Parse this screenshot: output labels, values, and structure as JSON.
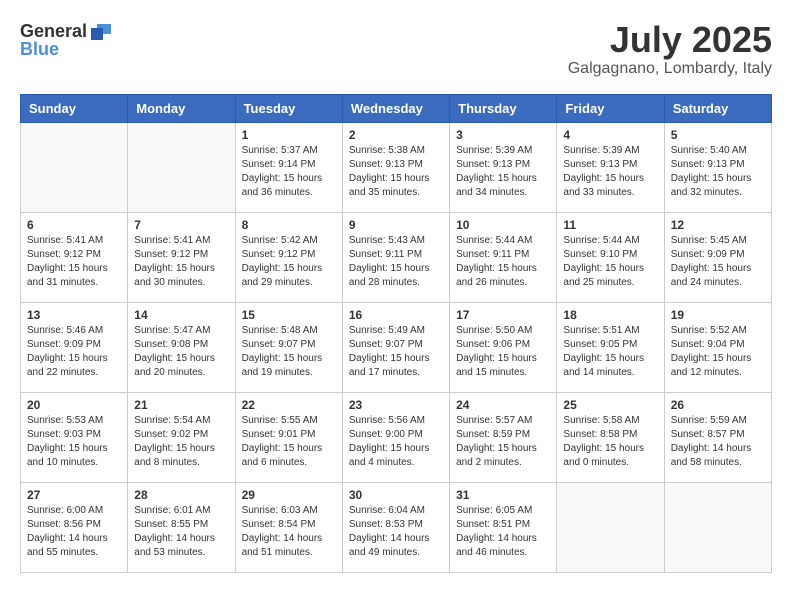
{
  "header": {
    "logo_general": "General",
    "logo_blue": "Blue",
    "title": "July 2025",
    "location": "Galgagnano, Lombardy, Italy"
  },
  "days_of_week": [
    "Sunday",
    "Monday",
    "Tuesday",
    "Wednesday",
    "Thursday",
    "Friday",
    "Saturday"
  ],
  "weeks": [
    [
      {
        "day": "",
        "info": ""
      },
      {
        "day": "",
        "info": ""
      },
      {
        "day": "1",
        "info": "Sunrise: 5:37 AM\nSunset: 9:14 PM\nDaylight: 15 hours and 36 minutes."
      },
      {
        "day": "2",
        "info": "Sunrise: 5:38 AM\nSunset: 9:13 PM\nDaylight: 15 hours and 35 minutes."
      },
      {
        "day": "3",
        "info": "Sunrise: 5:39 AM\nSunset: 9:13 PM\nDaylight: 15 hours and 34 minutes."
      },
      {
        "day": "4",
        "info": "Sunrise: 5:39 AM\nSunset: 9:13 PM\nDaylight: 15 hours and 33 minutes."
      },
      {
        "day": "5",
        "info": "Sunrise: 5:40 AM\nSunset: 9:13 PM\nDaylight: 15 hours and 32 minutes."
      }
    ],
    [
      {
        "day": "6",
        "info": "Sunrise: 5:41 AM\nSunset: 9:12 PM\nDaylight: 15 hours and 31 minutes."
      },
      {
        "day": "7",
        "info": "Sunrise: 5:41 AM\nSunset: 9:12 PM\nDaylight: 15 hours and 30 minutes."
      },
      {
        "day": "8",
        "info": "Sunrise: 5:42 AM\nSunset: 9:12 PM\nDaylight: 15 hours and 29 minutes."
      },
      {
        "day": "9",
        "info": "Sunrise: 5:43 AM\nSunset: 9:11 PM\nDaylight: 15 hours and 28 minutes."
      },
      {
        "day": "10",
        "info": "Sunrise: 5:44 AM\nSunset: 9:11 PM\nDaylight: 15 hours and 26 minutes."
      },
      {
        "day": "11",
        "info": "Sunrise: 5:44 AM\nSunset: 9:10 PM\nDaylight: 15 hours and 25 minutes."
      },
      {
        "day": "12",
        "info": "Sunrise: 5:45 AM\nSunset: 9:09 PM\nDaylight: 15 hours and 24 minutes."
      }
    ],
    [
      {
        "day": "13",
        "info": "Sunrise: 5:46 AM\nSunset: 9:09 PM\nDaylight: 15 hours and 22 minutes."
      },
      {
        "day": "14",
        "info": "Sunrise: 5:47 AM\nSunset: 9:08 PM\nDaylight: 15 hours and 20 minutes."
      },
      {
        "day": "15",
        "info": "Sunrise: 5:48 AM\nSunset: 9:07 PM\nDaylight: 15 hours and 19 minutes."
      },
      {
        "day": "16",
        "info": "Sunrise: 5:49 AM\nSunset: 9:07 PM\nDaylight: 15 hours and 17 minutes."
      },
      {
        "day": "17",
        "info": "Sunrise: 5:50 AM\nSunset: 9:06 PM\nDaylight: 15 hours and 15 minutes."
      },
      {
        "day": "18",
        "info": "Sunrise: 5:51 AM\nSunset: 9:05 PM\nDaylight: 15 hours and 14 minutes."
      },
      {
        "day": "19",
        "info": "Sunrise: 5:52 AM\nSunset: 9:04 PM\nDaylight: 15 hours and 12 minutes."
      }
    ],
    [
      {
        "day": "20",
        "info": "Sunrise: 5:53 AM\nSunset: 9:03 PM\nDaylight: 15 hours and 10 minutes."
      },
      {
        "day": "21",
        "info": "Sunrise: 5:54 AM\nSunset: 9:02 PM\nDaylight: 15 hours and 8 minutes."
      },
      {
        "day": "22",
        "info": "Sunrise: 5:55 AM\nSunset: 9:01 PM\nDaylight: 15 hours and 6 minutes."
      },
      {
        "day": "23",
        "info": "Sunrise: 5:56 AM\nSunset: 9:00 PM\nDaylight: 15 hours and 4 minutes."
      },
      {
        "day": "24",
        "info": "Sunrise: 5:57 AM\nSunset: 8:59 PM\nDaylight: 15 hours and 2 minutes."
      },
      {
        "day": "25",
        "info": "Sunrise: 5:58 AM\nSunset: 8:58 PM\nDaylight: 15 hours and 0 minutes."
      },
      {
        "day": "26",
        "info": "Sunrise: 5:59 AM\nSunset: 8:57 PM\nDaylight: 14 hours and 58 minutes."
      }
    ],
    [
      {
        "day": "27",
        "info": "Sunrise: 6:00 AM\nSunset: 8:56 PM\nDaylight: 14 hours and 55 minutes."
      },
      {
        "day": "28",
        "info": "Sunrise: 6:01 AM\nSunset: 8:55 PM\nDaylight: 14 hours and 53 minutes."
      },
      {
        "day": "29",
        "info": "Sunrise: 6:03 AM\nSunset: 8:54 PM\nDaylight: 14 hours and 51 minutes."
      },
      {
        "day": "30",
        "info": "Sunrise: 6:04 AM\nSunset: 8:53 PM\nDaylight: 14 hours and 49 minutes."
      },
      {
        "day": "31",
        "info": "Sunrise: 6:05 AM\nSunset: 8:51 PM\nDaylight: 14 hours and 46 minutes."
      },
      {
        "day": "",
        "info": ""
      },
      {
        "day": "",
        "info": ""
      }
    ]
  ]
}
